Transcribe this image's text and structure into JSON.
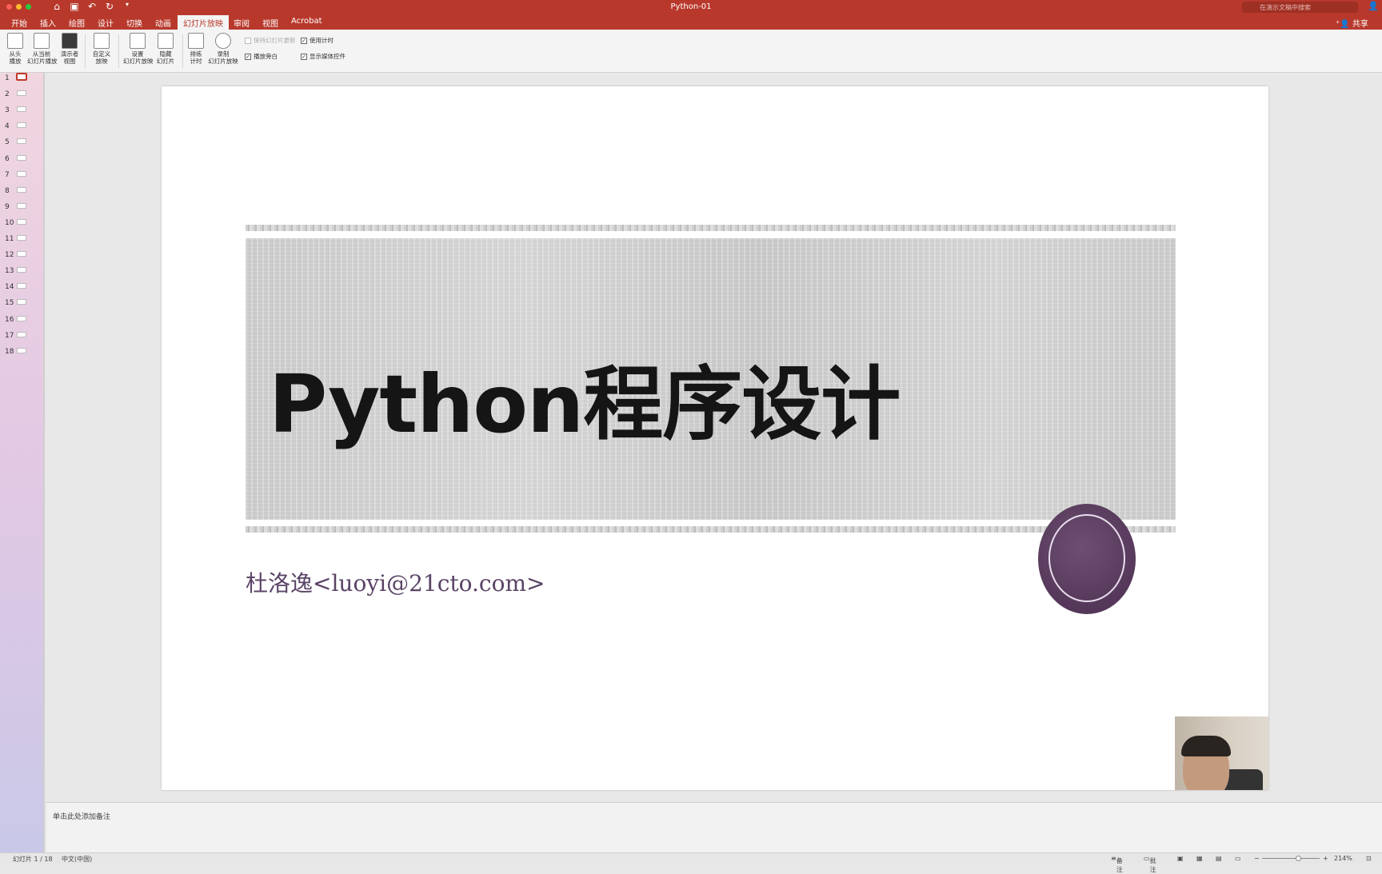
{
  "window": {
    "title": "Python-01",
    "search_placeholder": "在演示文稿中搜索",
    "share_label": "共享"
  },
  "tabs": [
    "开始",
    "插入",
    "绘图",
    "设计",
    "切换",
    "动画",
    "幻灯片放映",
    "审阅",
    "视图",
    "Acrobat"
  ],
  "active_tab": "幻灯片放映",
  "ribbon": {
    "from_start": "从头\n播放",
    "from_current": "从当前\n幻灯片播放",
    "presenter_view": "演示者\n视图",
    "custom_show": "自定义\n放映",
    "setup_show": "设置\n幻灯片放映",
    "hide_slide": "隐藏\n幻灯片",
    "rehearse": "排练\n计时",
    "record": "录制\n幻灯片放映",
    "keep_updated": "保持幻灯片更新",
    "play_narrations": "播放旁白",
    "use_timings": "使用计时",
    "show_media_controls": "显示媒体控件"
  },
  "thumbnails": [
    "1",
    "2",
    "3",
    "4",
    "5",
    "6",
    "7",
    "8",
    "9",
    "10",
    "11",
    "12",
    "13",
    "14",
    "15",
    "16",
    "17",
    "18"
  ],
  "selected_slide": 1,
  "slide": {
    "title": "Python程序设计",
    "subtitle": "杜洛逸<luoyi@21cto.com>"
  },
  "notes_placeholder": "单击此处添加备注",
  "status": {
    "slide_counter": "幻灯片 1 / 18",
    "language": "中文(中国)",
    "notes": "备注",
    "comments": "批注",
    "zoom": "214%"
  },
  "colors": {
    "accent": "#b8392c",
    "seal": "#5b3d5f"
  }
}
